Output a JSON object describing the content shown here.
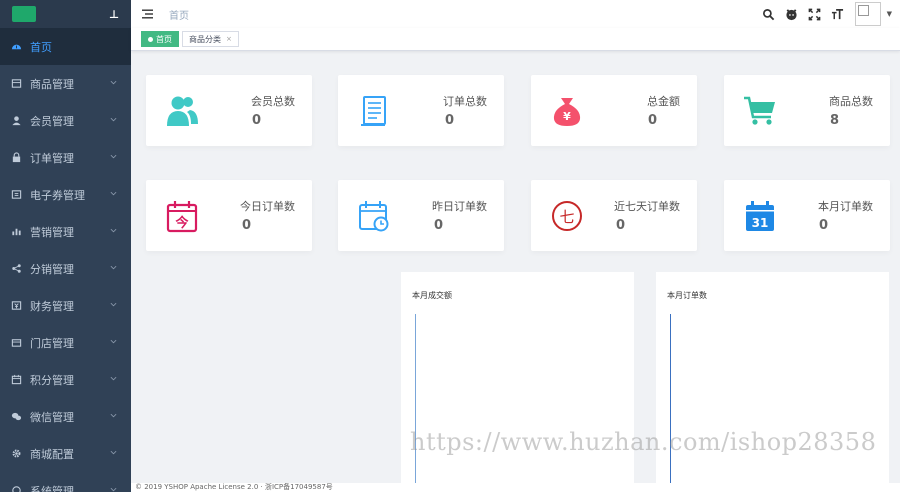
{
  "sidebar": {
    "items": [
      {
        "label": "首页",
        "icon": "dashboard-icon",
        "active": true
      },
      {
        "label": "商品管理",
        "icon": "shop-icon"
      },
      {
        "label": "会员管理",
        "icon": "user-icon"
      },
      {
        "label": "订单管理",
        "icon": "lock-icon"
      },
      {
        "label": "电子券管理",
        "icon": "coupon-icon"
      },
      {
        "label": "营销管理",
        "icon": "chart-icon"
      },
      {
        "label": "分销管理",
        "icon": "share-icon"
      },
      {
        "label": "财务管理",
        "icon": "money-icon"
      },
      {
        "label": "门店管理",
        "icon": "store-icon"
      },
      {
        "label": "积分管理",
        "icon": "calendar-icon"
      },
      {
        "label": "微信管理",
        "icon": "wechat-icon"
      },
      {
        "label": "商城配置",
        "icon": "gear-icon"
      },
      {
        "label": "系统管理",
        "icon": "system-icon"
      }
    ]
  },
  "topbar": {
    "breadcrumb": "首页"
  },
  "tags": [
    {
      "label": "首页",
      "active": true
    },
    {
      "label": "商品分类",
      "close": "×"
    }
  ],
  "stats": [
    {
      "label": "会员总数",
      "value": "0",
      "icon": "peoples-icon",
      "color": "#40c9c6"
    },
    {
      "label": "订单总数",
      "value": "0",
      "icon": "document-icon",
      "color": "#36a3f7"
    },
    {
      "label": "总金额",
      "value": "0",
      "icon": "money-bag-icon",
      "color": "#f4516c"
    },
    {
      "label": "商品总数",
      "value": "8",
      "icon": "shopping-cart-icon",
      "color": "#34bfa3"
    },
    {
      "label": "今日订单数",
      "value": "0",
      "icon": "today-calendar-icon",
      "color": "#d81b60",
      "glyph": "今"
    },
    {
      "label": "昨日订单数",
      "value": "0",
      "icon": "clock-calendar-icon",
      "color": "#36a3f7"
    },
    {
      "label": "近七天订单数",
      "value": "0",
      "icon": "seven-days-icon",
      "color": "#c62828",
      "glyph": "七"
    },
    {
      "label": "本月订单数",
      "value": "0",
      "icon": "month-calendar-icon",
      "color": "#1e88e5",
      "glyph": "31"
    }
  ],
  "charts": [
    {
      "title": "本月成交额"
    },
    {
      "title": "本月订单数"
    }
  ],
  "footer": "© 2019 YSHOP Apache License 2.0 · 浙ICP备17049587号",
  "watermark": "https://www.huzhan.com/ishop28358"
}
